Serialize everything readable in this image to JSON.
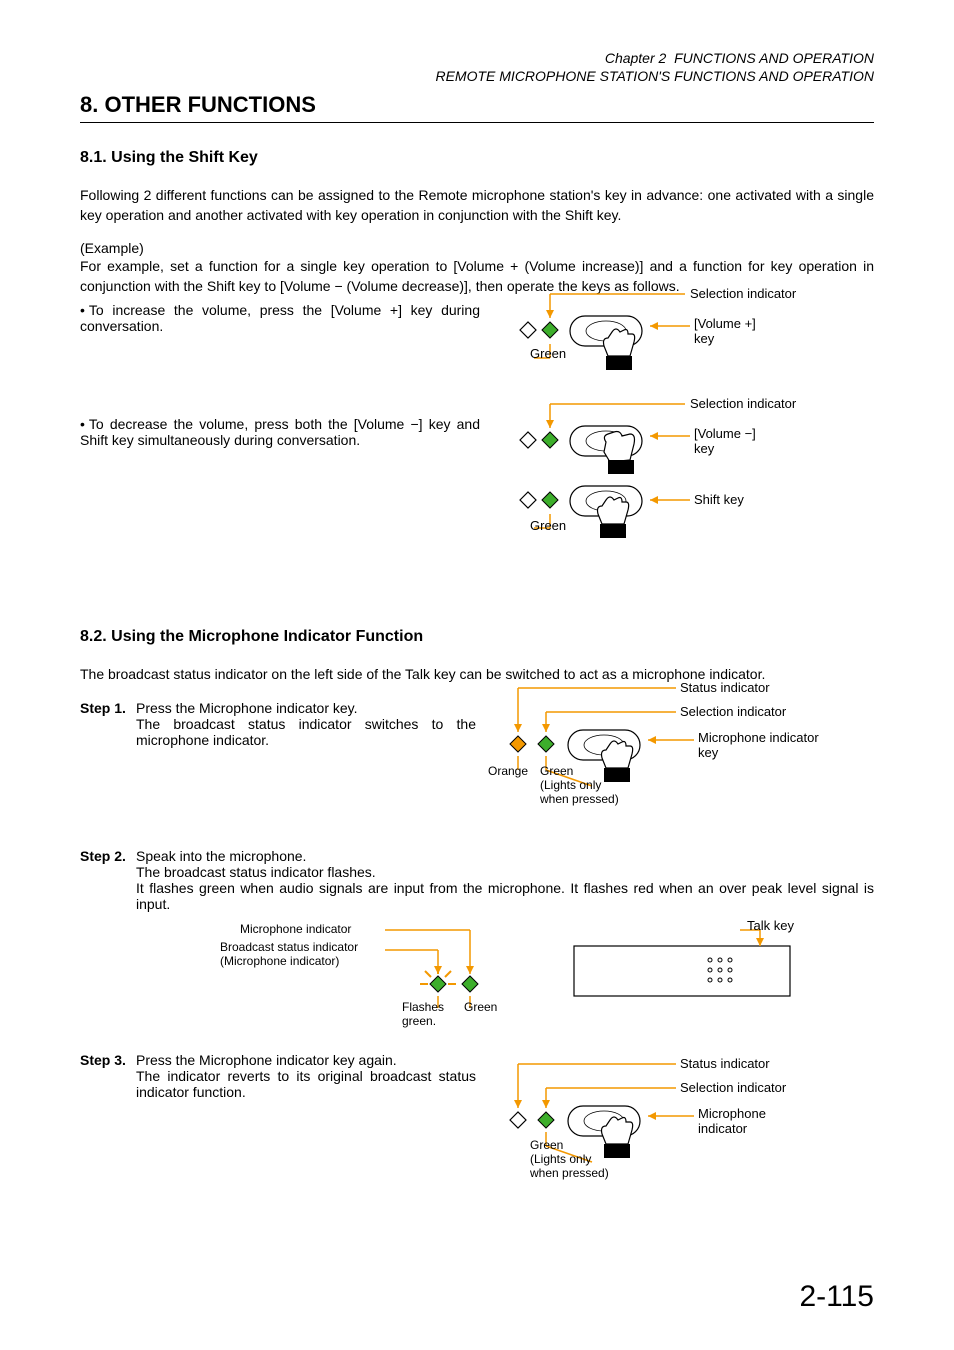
{
  "header": {
    "chapter_prefix": "Chapter 2",
    "chapter_title": "FUNCTIONS AND OPERATION",
    "chapter_subtitle": "REMOTE MICROPHONE STATION'S FUNCTIONS AND OPERATION"
  },
  "section8": {
    "title": "8. OTHER FUNCTIONS",
    "s81": {
      "heading": "8.1. Using the Shift Key",
      "intro": "Following 2 different functions can be assigned to the Remote microphone station's key in advance: one activated with a single key operation and another activated with key operation in conjunction with the Shift key.",
      "example_label": "(Example)",
      "example_body": "For example, set a function for a single key operation to [Volume + (Volume increase)] and a function for key operation in conjunction with the Shift key to [Volume − (Volume decrease)], then operate the keys as follows.",
      "bullet1": "To increase the volume, press the [Volume +] key during conversation.",
      "bullet2": "To decrease the volume, press both the [Volume −] key and Shift key simultaneously during conversation.",
      "diag1": {
        "selection_indicator": "Selection indicator",
        "vol_plus_key": "[Volume +]\nkey",
        "green": "Green"
      },
      "diag2": {
        "selection_indicator": "Selection indicator",
        "vol_minus_key": "[Volume −]\nkey",
        "shift_key": "Shift key",
        "green": "Green"
      }
    },
    "s82": {
      "heading": "8.2. Using the Microphone Indicator Function",
      "intro": "The broadcast status indicator on the left side of the Talk key can be switched to act as a microphone indicator.",
      "step1_label": "Step 1.",
      "step1_line1": "Press the Microphone indicator key.",
      "step1_line2": "The broadcast status indicator switches to the microphone indicator.",
      "step2_label": "Step 2.",
      "step2_line1": "Speak into the microphone.",
      "step2_line2": "The broadcast status indicator flashes.",
      "step2_line3": "It flashes green when audio signals are input from the microphone. It flashes red when an over peak level signal is input.",
      "step3_label": "Step 3.",
      "step3_line1": "Press the Microphone indicator key again.",
      "step3_line2": "The indicator reverts to its original broadcast status indicator function.",
      "diag_s1": {
        "status_indicator": "Status indicator",
        "selection_indicator": "Selection indicator",
        "mic_ind_key": "Microphone indicator\nkey",
        "orange": "Orange",
        "green": "Green",
        "lights_note": "(Lights only\nwhen pressed)"
      },
      "diag_s2": {
        "mic_indicator": "Microphone indicator",
        "broadcast_status": "Broadcast status indicator\n(Microphone indicator)",
        "flashes_green": "Flashes\ngreen.",
        "green": "Green",
        "talk_key": "Talk key"
      },
      "diag_s3": {
        "status_indicator": "Status indicator",
        "selection_indicator": "Selection indicator",
        "mic_indicator": "Microphone\nindicator",
        "green": "Green",
        "lights_note": "(Lights only\nwhen pressed)"
      }
    }
  },
  "page_number": "2-115"
}
